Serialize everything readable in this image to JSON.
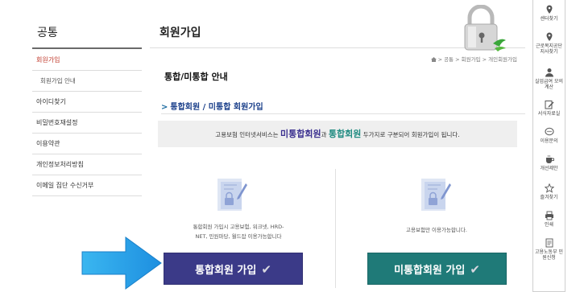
{
  "sidebar": {
    "title": "공통",
    "items": [
      {
        "label": "회원가입",
        "active": true
      },
      {
        "label": "회원가입 안내",
        "sub": true
      },
      {
        "label": "아이디찾기"
      },
      {
        "label": "비밀번호재설정"
      },
      {
        "label": "이용약관"
      },
      {
        "label": "개인정보처리방침"
      },
      {
        "label": "이메일 집단 수신거부"
      }
    ]
  },
  "main": {
    "page_title": "회원가입",
    "breadcrumb": "> 공통 > 회원가입 > 개인회원가입",
    "section_title": "통합/미통합 안내",
    "sub_title": "통합회원 / 미통합 회원가입",
    "sub_title_arrow": ">",
    "info": {
      "prefix": "고용보험 인터넷서비스는 ",
      "em1": "미통합회원",
      "mid": "과 ",
      "em2": "통합회원",
      "suffix": " 두가지로 구분되어 회원가입이 됩니다."
    },
    "integrated": {
      "desc_line1": "통합회원 가입시 고용보험, 워크넷, HRD-",
      "desc_line2": "NET, 민원마당, 월드잡 이용가능합니다",
      "button_label": "통합회원 가입",
      "check": "✔"
    },
    "nonintegrated": {
      "desc_line1": "고용보험만 이용가능합니다.",
      "button_label": "미통합회원 가입",
      "check": "✔"
    }
  },
  "quickbar": {
    "items": [
      {
        "label": "센터찾기",
        "icon": "map-pin-icon"
      },
      {
        "label": "근로복지공단 지사찾기",
        "icon": "map-pin-icon"
      },
      {
        "label": "실업급여 모의계산",
        "icon": "person-icon"
      },
      {
        "label": "서식자료실",
        "icon": "edit-icon"
      },
      {
        "label": "이용문의",
        "icon": "chat-icon"
      },
      {
        "label": "개선제안",
        "icon": "coffee-icon"
      },
      {
        "label": "즐겨찾기",
        "icon": "star-icon"
      },
      {
        "label": "인쇄",
        "icon": "print-icon"
      },
      {
        "label": "고용노동부 민원신청",
        "icon": "document-icon"
      }
    ]
  },
  "colors": {
    "integrated_button": "#3b3a88",
    "nonintegrated_button": "#1f7a78",
    "accent_red": "#c0392b",
    "arrow_blue": "#2aa0e8"
  }
}
